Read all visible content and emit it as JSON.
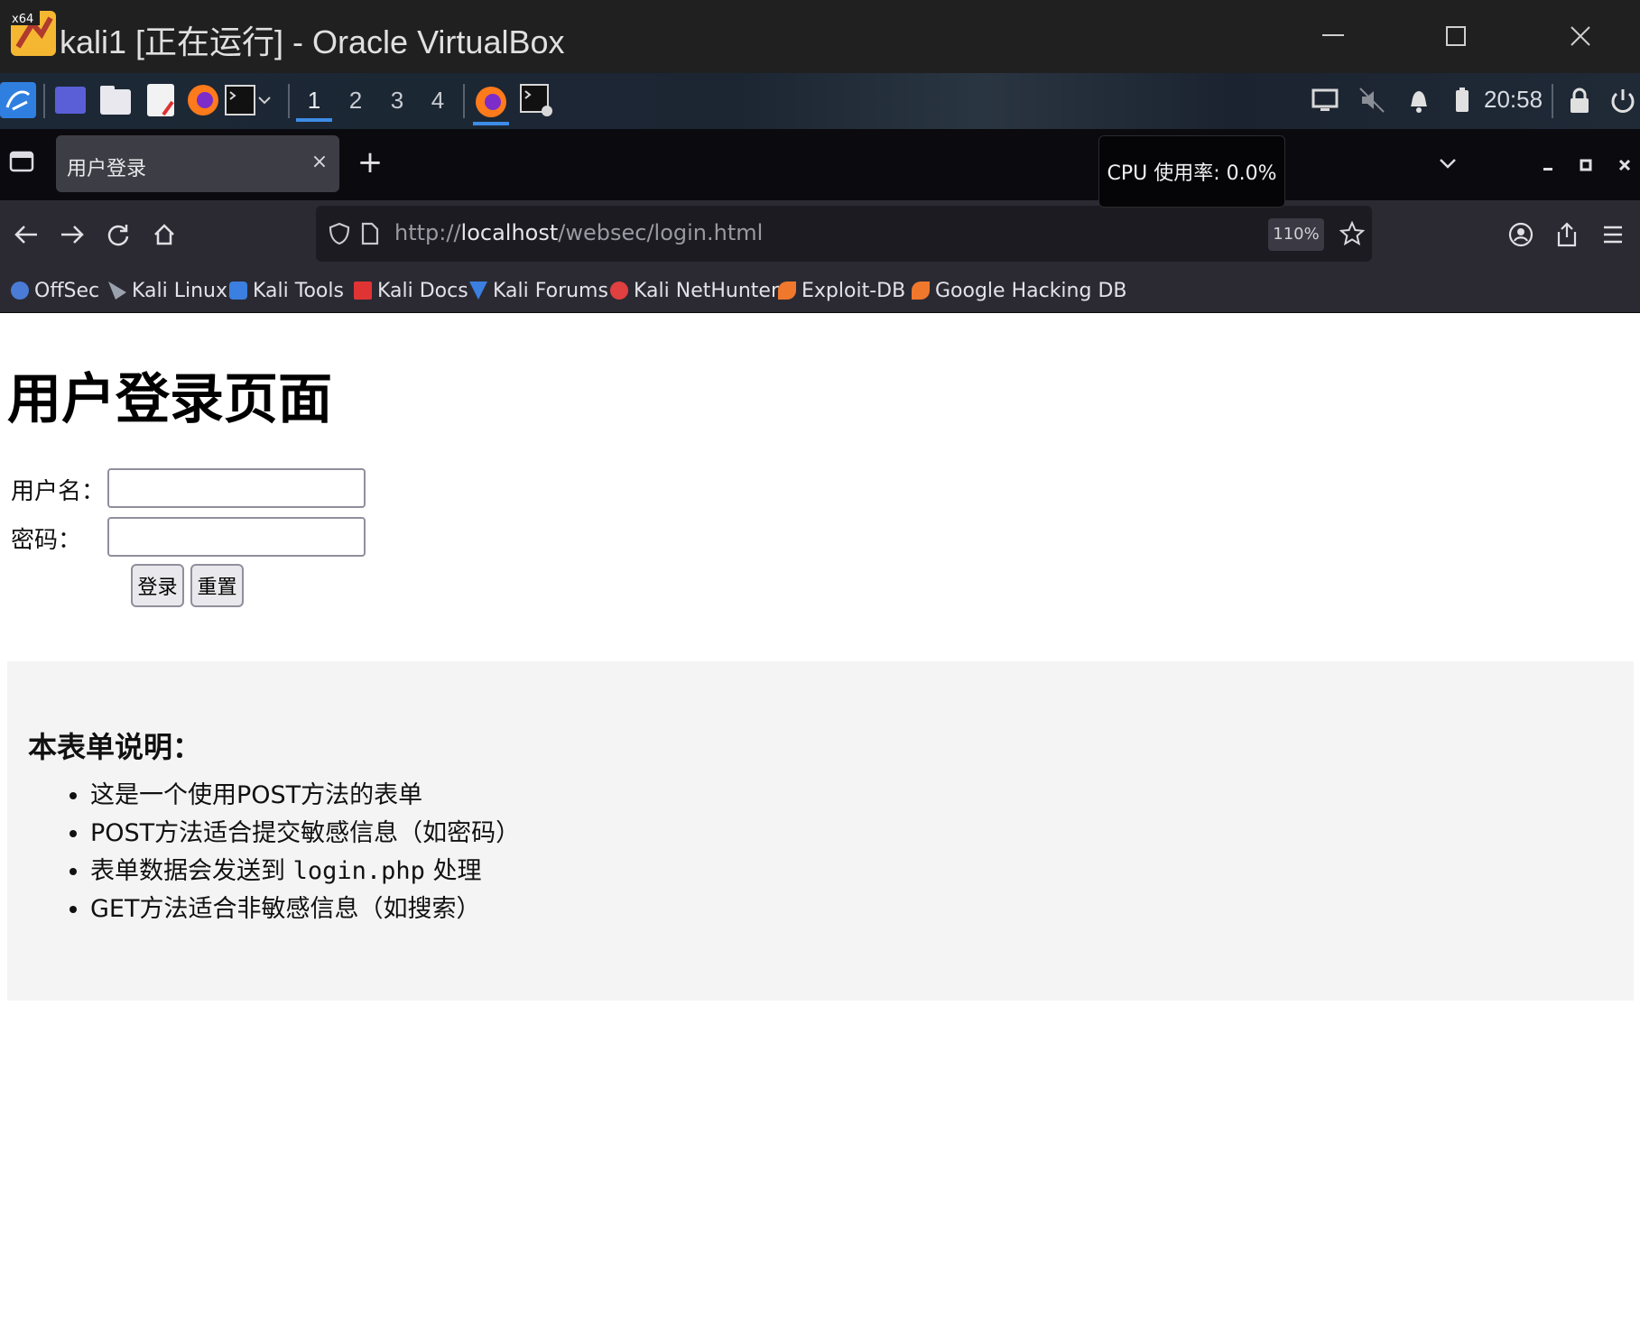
{
  "window": {
    "badge": "x64",
    "title": "kali1 [正在运行] - Oracle VirtualBox"
  },
  "panel": {
    "workspaces": [
      "1",
      "2",
      "3",
      "4"
    ],
    "active_workspace": "1",
    "clock": "20:58",
    "accent": "#3d8ce6"
  },
  "browser": {
    "tab": {
      "title": "用户登录",
      "close": "×"
    },
    "new_tab": "+",
    "tooltip": "CPU 使用率: 0.0%",
    "url": {
      "scheme": "http://",
      "host": "localhost",
      "path": "/websec/login.html"
    },
    "zoom": "110%",
    "bookmarks": [
      {
        "label": "OffSec",
        "icon": "offsec-icon",
        "color": "#4a7bd6"
      },
      {
        "label": "Kali Linux",
        "icon": "kali-dragon-icon",
        "color": "#9aa2ad"
      },
      {
        "label": "Kali Tools",
        "icon": "kali-tools-icon",
        "color": "#3b7fe0"
      },
      {
        "label": "Kali Docs",
        "icon": "kali-docs-icon",
        "color": "#e03434"
      },
      {
        "label": "Kali Forums",
        "icon": "kali-forums-icon",
        "color": "#3b7fe0"
      },
      {
        "label": "Kali NetHunter",
        "icon": "nethunter-icon",
        "color": "#e04040"
      },
      {
        "label": "Exploit-DB",
        "icon": "exploit-db-icon",
        "color": "#f0782c"
      },
      {
        "label": "Google Hacking DB",
        "icon": "ghdb-icon",
        "color": "#f0782c"
      }
    ]
  },
  "page": {
    "heading": "用户登录页面",
    "username_label": "用户名：",
    "password_label": "密码：",
    "username_value": "",
    "password_value": "",
    "login_button": "登录",
    "reset_button": "重置",
    "info": {
      "title": "本表单说明：",
      "items": [
        {
          "text": "这是一个使用POST方法的表单"
        },
        {
          "text": "POST方法适合提交敏感信息（如密码）"
        },
        {
          "before": "表单数据会发送到 ",
          "code": "login.php",
          "after": " 处理"
        },
        {
          "text": "GET方法适合非敏感信息（如搜索）"
        }
      ]
    }
  }
}
